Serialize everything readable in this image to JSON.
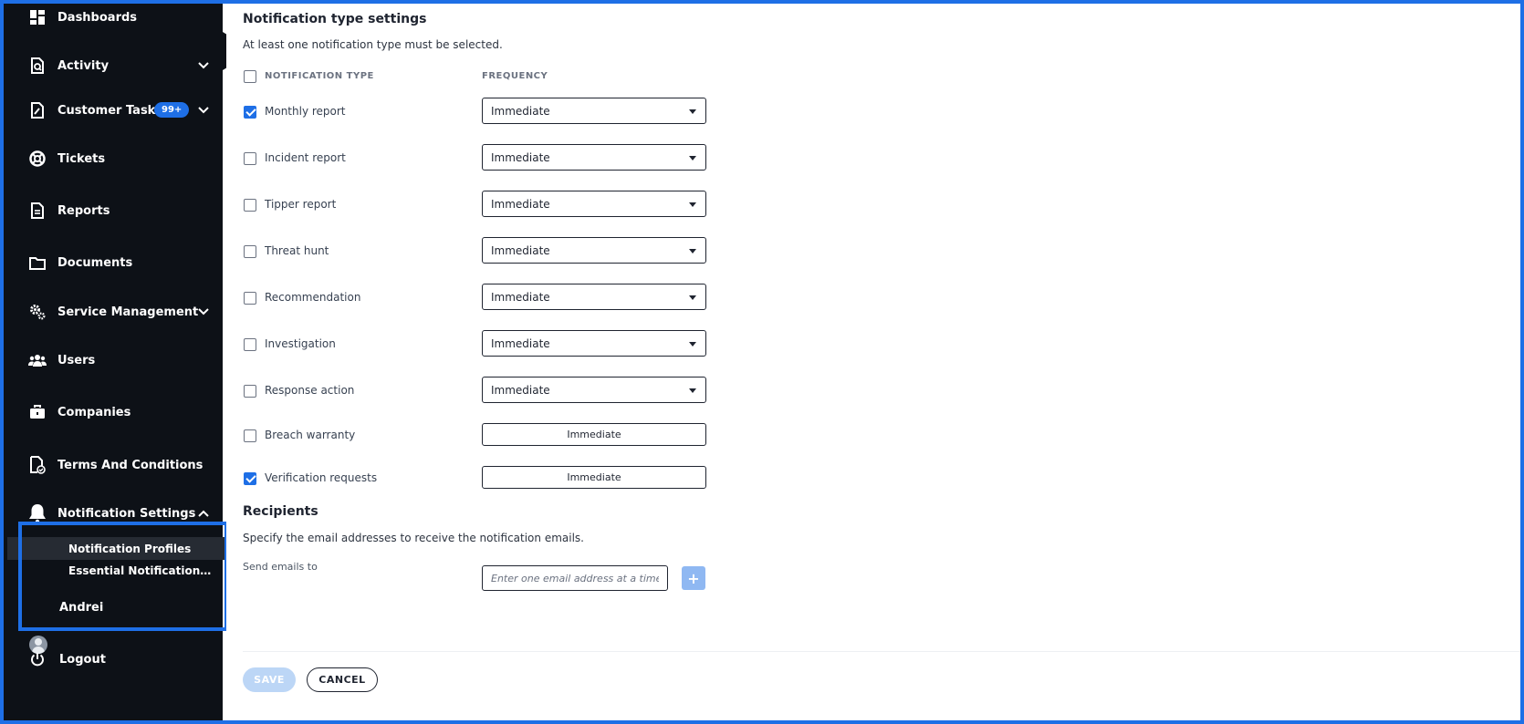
{
  "sidebar": {
    "items": [
      {
        "label": "Dashboards",
        "icon": "dashboard-icon"
      },
      {
        "label": "Activity",
        "icon": "activity-icon",
        "expandable": true
      },
      {
        "label": "Customer Tasks",
        "icon": "tasks-icon",
        "badge": "99+",
        "expandable": true
      },
      {
        "label": "Tickets",
        "icon": "lifebuoy-icon"
      },
      {
        "label": "Reports",
        "icon": "report-icon"
      },
      {
        "label": "Documents",
        "icon": "folder-icon"
      },
      {
        "label": "Service Management",
        "icon": "gears-icon",
        "expandable": true
      },
      {
        "label": "Users",
        "icon": "users-icon"
      },
      {
        "label": "Companies",
        "icon": "briefcase-icon"
      },
      {
        "label": "Terms And Conditions",
        "icon": "document-check-icon"
      },
      {
        "label": "Notification Settings",
        "icon": "bell-icon",
        "expanded": true
      }
    ],
    "sub_items": [
      {
        "label": "Notification Profiles",
        "active": true
      },
      {
        "label": "Essential Notifications Se...",
        "active": false
      }
    ],
    "user": {
      "name": "Andrei"
    },
    "logout_label": "Logout"
  },
  "main": {
    "section_title": "Notification type settings",
    "section_note": "At least one notification type must be selected.",
    "col_type": "NOTIFICATION TYPE",
    "col_frequency": "FREQUENCY",
    "rows": [
      {
        "label": "Monthly report",
        "checked": true,
        "frequency": "Immediate",
        "control": "select"
      },
      {
        "label": "Incident report",
        "checked": false,
        "frequency": "Immediate",
        "control": "select"
      },
      {
        "label": "Tipper report",
        "checked": false,
        "frequency": "Immediate",
        "control": "select"
      },
      {
        "label": "Threat hunt",
        "checked": false,
        "frequency": "Immediate",
        "control": "select"
      },
      {
        "label": "Recommendation",
        "checked": false,
        "frequency": "Immediate",
        "control": "select"
      },
      {
        "label": "Investigation",
        "checked": false,
        "frequency": "Immediate",
        "control": "select"
      },
      {
        "label": "Response action",
        "checked": false,
        "frequency": "Immediate",
        "control": "select"
      },
      {
        "label": "Breach warranty",
        "checked": false,
        "frequency": "Immediate",
        "control": "button"
      },
      {
        "label": "Verification requests",
        "checked": true,
        "frequency": "Immediate",
        "control": "button"
      }
    ],
    "recipients": {
      "title": "Recipients",
      "note": "Specify the email addresses to receive the notification emails.",
      "send_label": "Send emails to",
      "placeholder": "Enter one email address at a time",
      "add_label": "+"
    },
    "footer": {
      "save_label": "SAVE",
      "cancel_label": "CANCEL"
    }
  },
  "colors": {
    "accent": "#1e6fe6",
    "sidebar_bg": "#0d1117",
    "save_disabled": "#bcd6f6"
  }
}
